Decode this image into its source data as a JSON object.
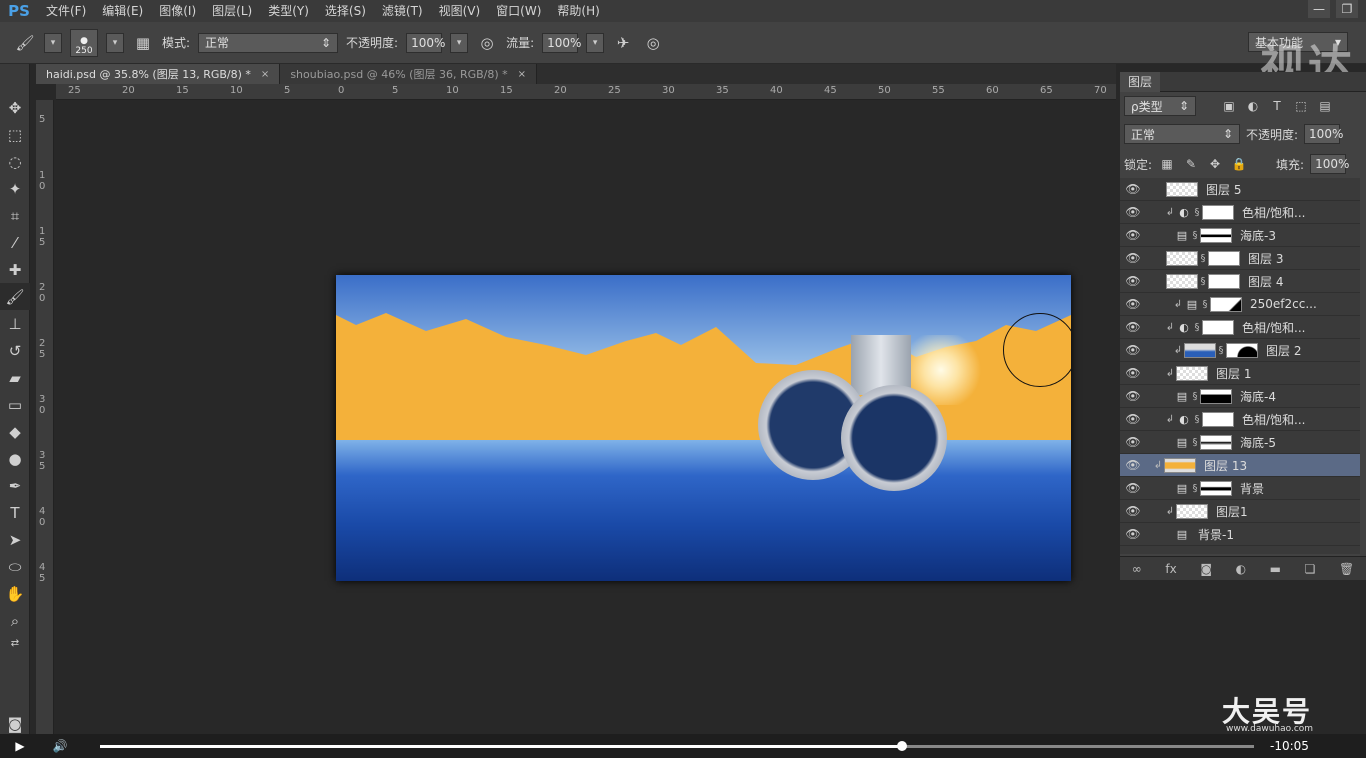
{
  "app": {
    "logo": "PS"
  },
  "menu": [
    "文件(F)",
    "编辑(E)",
    "图像(I)",
    "图层(L)",
    "类型(Y)",
    "选择(S)",
    "滤镜(T)",
    "视图(V)",
    "窗口(W)",
    "帮助(H)"
  ],
  "window": {
    "minimize": "—",
    "restore": "❐"
  },
  "watermark_top": "视达",
  "options": {
    "brush_size": "250",
    "mode_label": "模式:",
    "mode_value": "正常",
    "opacity_label": "不透明度:",
    "opacity_value": "100%",
    "flow_label": "流量:",
    "flow_value": "100%",
    "workspace": "基本功能"
  },
  "tabs": [
    {
      "label": "haidi.psd @ 35.8% (图层 13, RGB/8) *",
      "close": "×"
    },
    {
      "label": "shoubiao.psd @ 46% (图层 36, RGB/8) *",
      "close": "×"
    }
  ],
  "ruler_top": [
    "25",
    "20",
    "15",
    "10",
    "5",
    "0",
    "5",
    "10",
    "15",
    "20",
    "25",
    "30",
    "35",
    "40",
    "45",
    "50",
    "55",
    "60",
    "65",
    "70"
  ],
  "ruler_left": [
    "5",
    "1\n0",
    "1\n5",
    "2\n0",
    "2\n5",
    "3\n0",
    "3\n5",
    "4\n0",
    "4\n5"
  ],
  "layers_panel": {
    "title": "图层",
    "filter": "ρ类型",
    "blend": "正常",
    "opacity_label": "不透明度:",
    "opacity_value": "100%",
    "lock_label": "锁定:",
    "fill_label": "填充:",
    "fill_value": "100%",
    "layers": [
      {
        "name": "图层 5"
      },
      {
        "name": "色相/饱和..."
      },
      {
        "name": "海底-3"
      },
      {
        "name": "图层 3"
      },
      {
        "name": "图层 4"
      },
      {
        "name": "250ef2cc..."
      },
      {
        "name": "色相/饱和..."
      },
      {
        "name": "图层 2"
      },
      {
        "name": "图层 1"
      },
      {
        "name": "海底-4"
      },
      {
        "name": "色相/饱和..."
      },
      {
        "name": "海底-5"
      },
      {
        "name": "图层 13",
        "selected": true
      },
      {
        "name": "背景"
      },
      {
        "name": "图层1"
      },
      {
        "name": "背景-1"
      }
    ]
  },
  "video": {
    "time": "-10:05",
    "progress": 0.695
  },
  "watermark_bottom": "大吴号",
  "watermark_url": "www.dawuhao.com",
  "colors": {
    "foreground": "#f6b338",
    "accent_select": "#5b6a86"
  }
}
